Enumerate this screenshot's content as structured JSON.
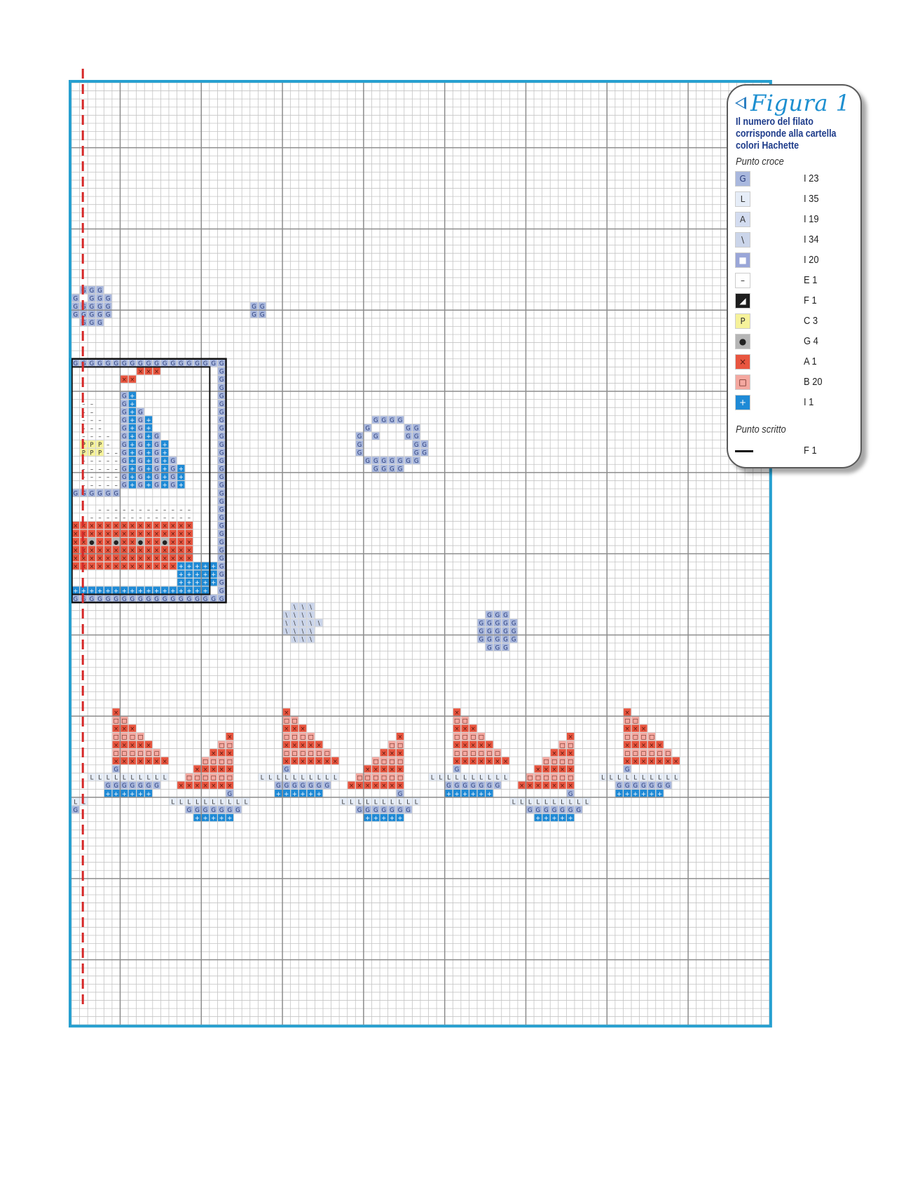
{
  "legend": {
    "title": "Figura 1",
    "description": "Il numero del filato corrisponde alla cartella colori Hachette",
    "section_cross": "Punto croce",
    "cross_stitch": [
      {
        "symbol": "G",
        "code": "I 23",
        "color": "#a9b8de",
        "text_color": "#2a3c7a"
      },
      {
        "symbol": "L",
        "code": "I 35",
        "color": "#e6edf8",
        "text_color": "#333"
      },
      {
        "symbol": "A",
        "code": "I 19",
        "color": "#d3dcf0",
        "text_color": "#333"
      },
      {
        "symbol": "\\",
        "code": "I 34",
        "color": "#cbd5ea",
        "text_color": "#333"
      },
      {
        "symbol": "■",
        "code": "I 20",
        "color": "#9aa6d8",
        "text_color": "#ffffff"
      },
      {
        "symbol": "–",
        "code": "E 1",
        "color": "#ffffff",
        "text_color": "#222"
      },
      {
        "symbol": "◢",
        "code": "F 1",
        "color": "#1e1e1e",
        "text_color": "#ffffff"
      },
      {
        "symbol": "P",
        "code": "C 3",
        "color": "#f6f29a",
        "text_color": "#333"
      },
      {
        "symbol": "●",
        "code": "G 4",
        "color": "#b5b5b5",
        "text_color": "#222"
      },
      {
        "symbol": "×",
        "code": "A 1",
        "color": "#e8553f",
        "text_color": "#5a1a10"
      },
      {
        "symbol": "□",
        "code": "B 20",
        "color": "#f4a8a0",
        "text_color": "#5a1a10"
      },
      {
        "symbol": "+",
        "code": "I 1",
        "color": "#1e8ad6",
        "text_color": "#ffffff"
      }
    ],
    "section_back": "Punto scritto",
    "backstitch": [
      {
        "code": "F 1",
        "color": "#111111"
      }
    ]
  },
  "chart": {
    "border_color": "#27a0d0",
    "grid_color": "#c4c4c4",
    "major_grid_color": "#8c8c8c",
    "center_line_color": "#d62828"
  }
}
